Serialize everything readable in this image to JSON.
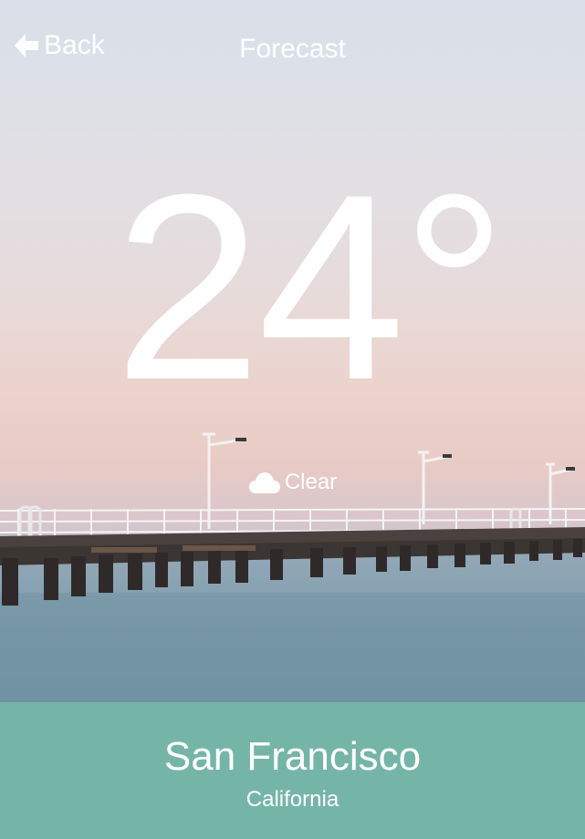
{
  "header": {
    "back_label": "Back",
    "title": "Forecast",
    "back_icon": "arrow-left-icon"
  },
  "weather": {
    "temperature": "24°",
    "condition": "Clear",
    "condition_icon": "cloud-icon"
  },
  "location": {
    "city": "San Francisco",
    "region": "California"
  },
  "colors": {
    "footer_background": "#75b5a8",
    "text": "#ffffff"
  }
}
